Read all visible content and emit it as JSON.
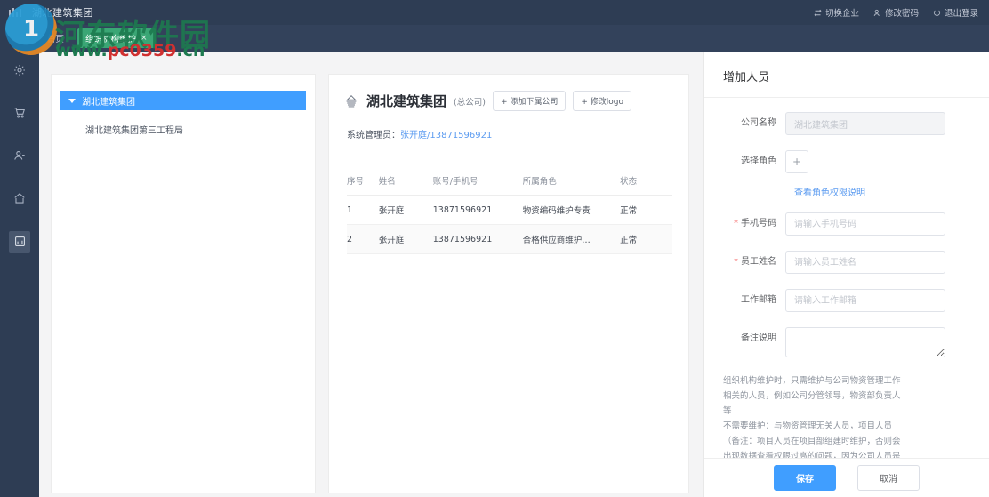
{
  "topbar": {
    "brand": "湖北建筑集团",
    "nav": [
      {
        "label": "切换企业",
        "icon": "switch-icon"
      },
      {
        "label": "修改密码",
        "icon": "user-key-icon"
      },
      {
        "label": "退出登录",
        "icon": "power-icon"
      }
    ]
  },
  "tabs": [
    {
      "label": "首页",
      "active": false,
      "closable": false
    },
    {
      "label": "组织机构维护",
      "active": true,
      "closable": true,
      "close": "×"
    }
  ],
  "rail": {
    "items": [
      {
        "icon": "gear-icon",
        "active": false
      },
      {
        "icon": "cart-icon",
        "active": false
      },
      {
        "icon": "user-icon",
        "active": false
      },
      {
        "icon": "home-icon",
        "active": false
      },
      {
        "icon": "report-icon",
        "active": true
      }
    ]
  },
  "tree": {
    "root": "湖北建筑集团",
    "children": [
      "湖北建筑集团第三工程局"
    ]
  },
  "detail": {
    "org_name": "湖北建筑集团",
    "org_type": "(总公司)",
    "add_sub_company": "+ 添加下属公司",
    "change_logo": "+ 修改logo",
    "admin_label": "系统管理员：",
    "admin_value": "张开庭/13871596921",
    "table": {
      "headers": [
        "序号",
        "姓名",
        "账号/手机号",
        "所属角色",
        "状态"
      ],
      "rows": [
        [
          "1",
          "张开庭",
          "13871596921",
          "物资编码维护专责",
          "正常"
        ],
        [
          "2",
          "张开庭",
          "13871596921",
          "合格供应商维护…",
          "正常"
        ]
      ]
    }
  },
  "drawer": {
    "title": "增加人员",
    "company_label": "公司名称",
    "company_value": "湖北建筑集团",
    "role_label": "选择角色",
    "role_add_btn": "+",
    "role_link": "查看角色权限说明",
    "phone_label": "手机号码",
    "phone_placeholder": "请输入手机号码",
    "name_label": "员工姓名",
    "name_placeholder": "请输入员工姓名",
    "email_label": "工作邮箱",
    "email_placeholder": "请输入工作邮箱",
    "remark_label": "备注说明",
    "remark_value": "",
    "help_lines": [
      "组织机构维护时，只需维护与公司物资管理工作",
      "相关的人员，例如公司分管领导，物资部负责人",
      "等",
      "不需要维护：与物资管理无关人员，项目人员",
      "（备注：项目人员在项目部组建时维护，否则会",
      "出现数据查看权限过高的问题，因为公司人员是"
    ],
    "save_label": "保存",
    "cancel_label": "取消"
  },
  "watermark": {
    "text_cn": "河东软件园",
    "url_prefix": "www.",
    "url_main": "pc0359",
    "url_suffix": ".cn"
  },
  "colors": {
    "header_bg": "#2e3d54",
    "tab_active": "#3aa675",
    "accent": "#409eff",
    "tree_selected": "#409eff",
    "link": "#5b9bf0",
    "required": "#f56c6c"
  }
}
